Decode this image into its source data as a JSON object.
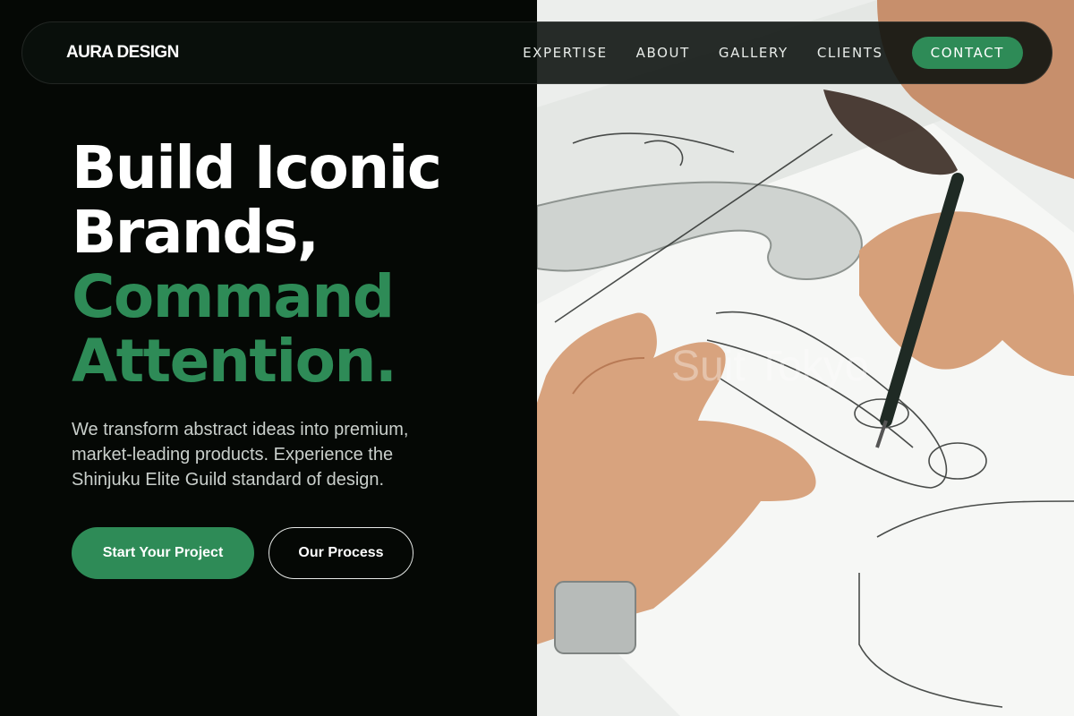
{
  "brand": {
    "logo_text": "AURA DESIGN"
  },
  "nav": {
    "links": [
      {
        "label": "EXPERTISE"
      },
      {
        "label": "ABOUT"
      },
      {
        "label": "GALLERY"
      },
      {
        "label": "CLIENTS"
      }
    ],
    "contact_label": "CONTACT"
  },
  "hero": {
    "headline_line1": "Build Iconic",
    "headline_line2": "Brands,",
    "headline_accent1": "Command",
    "headline_accent2": "Attention.",
    "subtext": "We transform abstract ideas into premium, market-leading products. Experience the Shinjuku Elite Guild standard of design.",
    "primary_button": "Start Your Project",
    "secondary_button": "Our Process"
  },
  "colors": {
    "accent": "#2e8b57",
    "background": "#050805",
    "text_primary": "#ffffff",
    "text_secondary": "#c9cfcb"
  }
}
